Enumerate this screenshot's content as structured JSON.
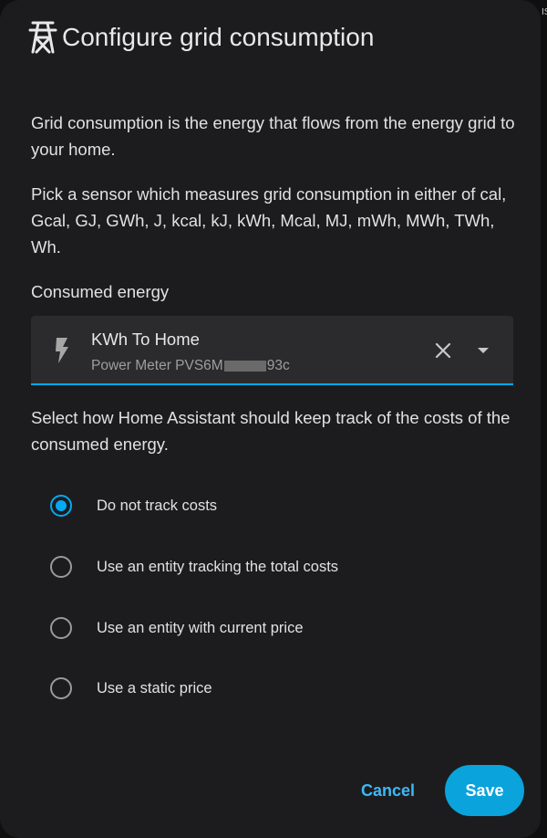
{
  "dialog": {
    "title": "Configure grid consumption",
    "title_icon": "transmission-tower-icon",
    "description": "Grid consumption is the energy that flows from the energy grid to your home.",
    "sensor_hint": "Pick a sensor which measures grid consumption in either of cal, Gcal, GJ, GWh, J, kcal, kJ, kWh, Mcal, MJ, mWh, MWh, TWh, Wh."
  },
  "field": {
    "label": "Consumed energy",
    "value_primary": "KWh To Home",
    "value_secondary_prefix": "Power Meter PVS6M",
    "value_secondary_suffix": "93c",
    "icon": "lightning-bolt-icon",
    "accent": "#03a9f4"
  },
  "cost": {
    "prompt": "Select how Home Assistant should keep track of the costs of the consumed energy.",
    "options": [
      {
        "label": "Do not track costs",
        "checked": true
      },
      {
        "label": "Use an entity tracking the total costs",
        "checked": false
      },
      {
        "label": "Use an entity with current price",
        "checked": false
      },
      {
        "label": "Use a static price",
        "checked": false
      }
    ]
  },
  "actions": {
    "cancel": "Cancel",
    "save": "Save",
    "primary_color": "#0aa3dc"
  },
  "edge_text": "IS"
}
